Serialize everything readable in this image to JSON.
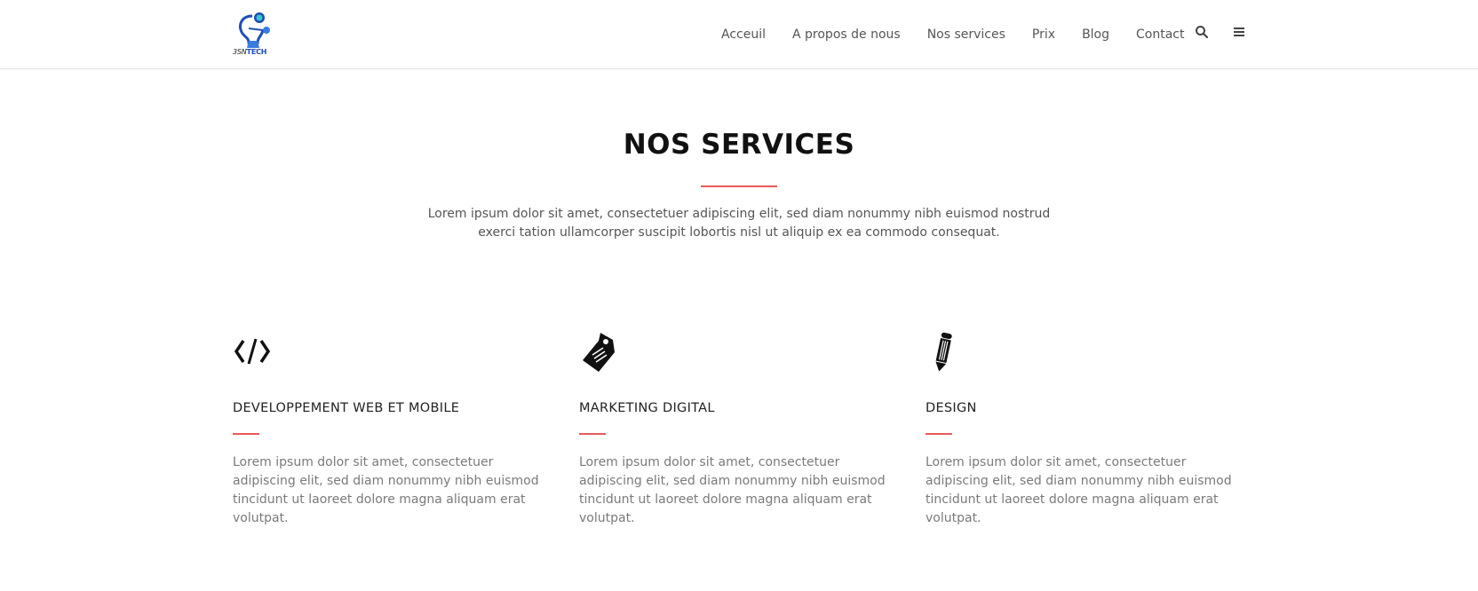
{
  "header": {
    "logo": {
      "text_prefix": "3SN",
      "text_brand": "TECH"
    },
    "nav": [
      {
        "label": "Acceuil"
      },
      {
        "label": "A propos de nous"
      },
      {
        "label": "Nos services"
      },
      {
        "label": "Prix"
      },
      {
        "label": "Blog"
      },
      {
        "label": "Contact"
      }
    ],
    "icons": [
      "search-icon",
      "menu-icon"
    ]
  },
  "section": {
    "title": "NOS SERVICES",
    "intro": "Lorem ipsum dolor sit amet, consectetuer adipiscing elit, sed diam nonummy nibh euismod nostrud exerci tation ullamcorper suscipit lobortis nisl ut aliquip ex ea commodo consequat.",
    "accent_color": "#ea5a5a"
  },
  "services": [
    {
      "icon": "code-icon",
      "title": "DEVELOPPEMENT WEB ET MOBILE",
      "text": "Lorem ipsum dolor sit amet, consectetuer adipiscing elit, sed diam nonummy nibh euismod tincidunt ut laoreet dolore magna aliquam erat volutpat."
    },
    {
      "icon": "tag-icon",
      "title": "MARKETING DIGITAL",
      "text": "Lorem ipsum dolor sit amet, consectetuer adipiscing elit, sed diam nonummy nibh euismod tincidunt ut laoreet dolore magna aliquam erat volutpat."
    },
    {
      "icon": "pencil-icon",
      "title": "DESIGN",
      "text": "Lorem ipsum dolor sit amet, consectetuer adipiscing elit, sed diam nonummy nibh euismod tincidunt ut laoreet dolore magna aliquam erat volutpat."
    }
  ]
}
